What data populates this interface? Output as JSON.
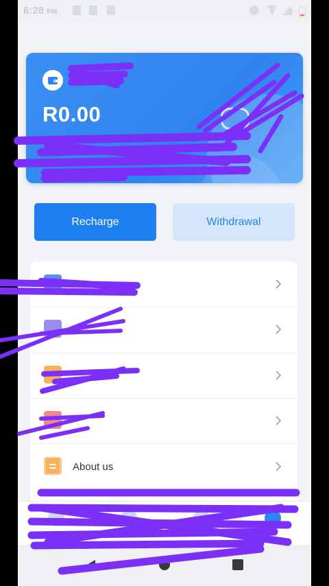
{
  "status_bar": {
    "time": "6:28",
    "ampm": "PM"
  },
  "wallet": {
    "card_label": "",
    "balance": "R0.00",
    "icons": {
      "wallet": "wallet-icon",
      "visibility": "eye-toggle-icon"
    }
  },
  "actions": {
    "recharge_label": "Recharge",
    "withdrawal_label": "Withdrawal"
  },
  "menu": {
    "items": [
      {
        "label": "",
        "icon": "card-icon",
        "color": "#5b8def"
      },
      {
        "label": "",
        "icon": "bill-icon",
        "color": "#9a8cf0"
      },
      {
        "label": "",
        "icon": "coupon-icon",
        "color": "#f4b25a"
      },
      {
        "label": "",
        "icon": "gift-icon",
        "color": "#f08a8a"
      },
      {
        "label": "About us",
        "icon": "document-icon",
        "color": "#f6b15a"
      }
    ]
  },
  "colors": {
    "primary": "#1d7ff0",
    "primary_light": "#d3e6fc",
    "background": "#f2f3f7",
    "redaction": "#7b2ff7"
  }
}
